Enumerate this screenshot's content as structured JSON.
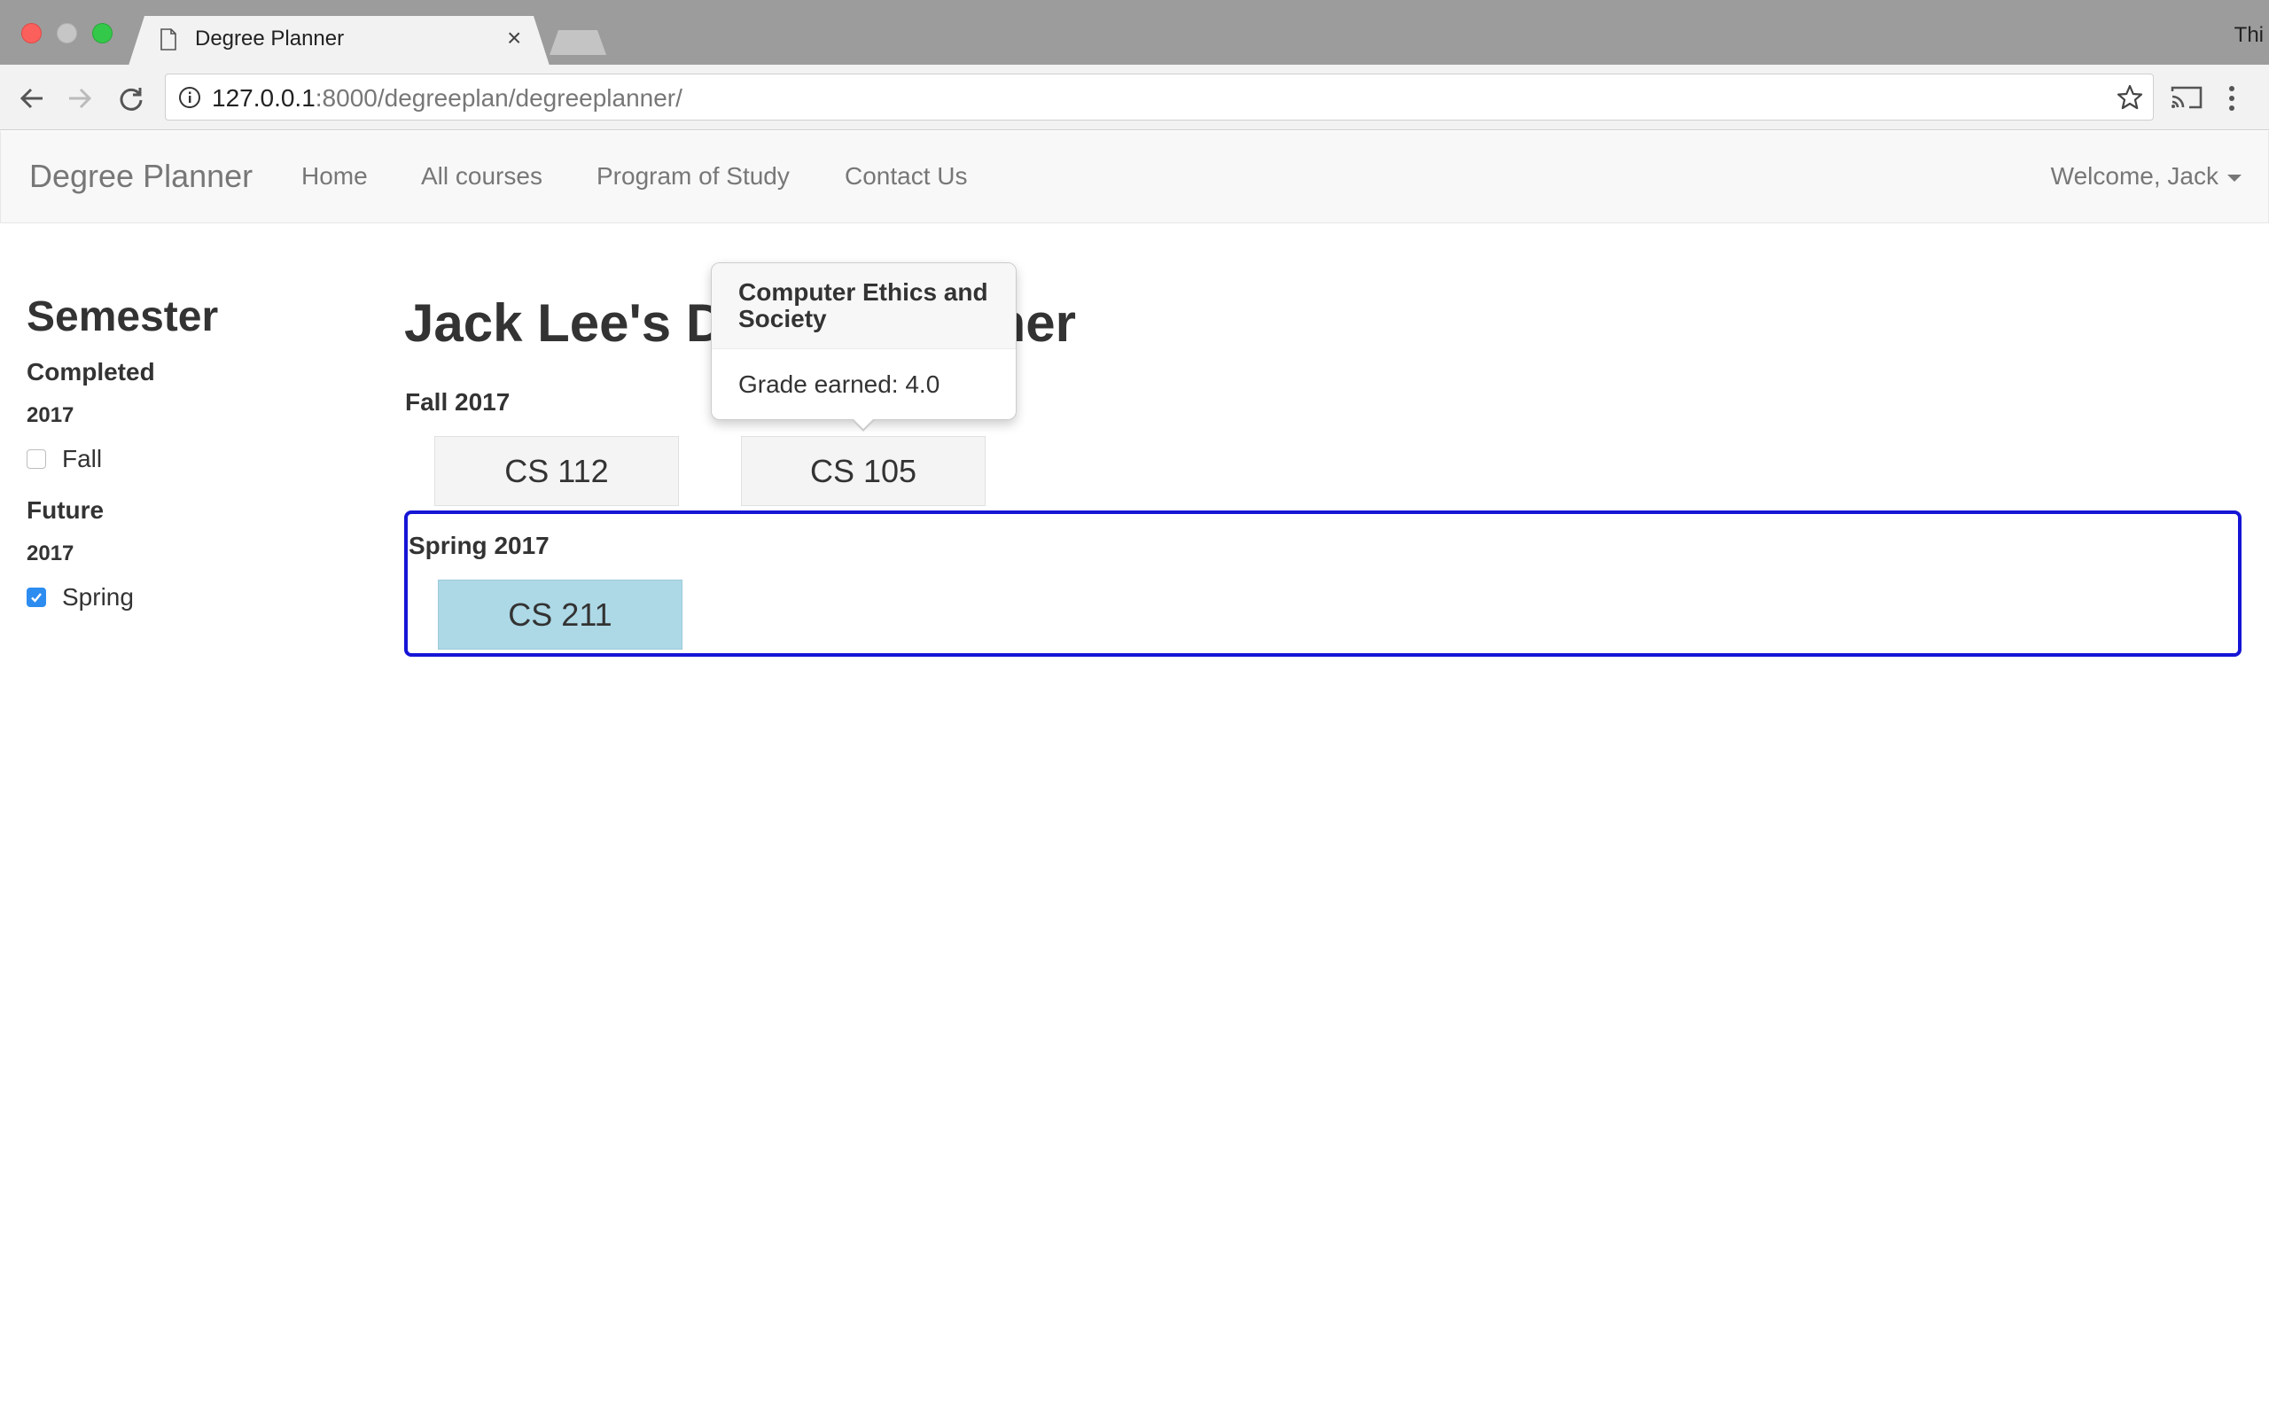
{
  "browser": {
    "tab_title": "Degree Planner",
    "profile_text": "Thi",
    "url_host": "127.0.0.1",
    "url_rest": ":8000/degreeplan/degreeplanner/"
  },
  "navbar": {
    "brand": "Degree Planner",
    "links": [
      "Home",
      "All courses",
      "Program of Study",
      "Contact Us"
    ],
    "welcome": "Welcome, Jack"
  },
  "sidebar": {
    "heading": "Semester",
    "completed": {
      "label": "Completed",
      "year": "2017",
      "items": [
        {
          "label": "Fall",
          "checked": false
        }
      ]
    },
    "future": {
      "label": "Future",
      "year": "2017",
      "items": [
        {
          "label": "Spring",
          "checked": true
        }
      ]
    }
  },
  "main": {
    "title": "Jack Lee's Degree Planner",
    "semesters": [
      {
        "label": "Fall 2017",
        "courses": [
          "CS 112",
          "CS 105"
        ]
      },
      {
        "label": "Spring 2017",
        "courses": [
          "CS 211"
        ]
      }
    ]
  },
  "popover": {
    "title": "Computer Ethics and Society",
    "body": "Grade earned: 4.0"
  },
  "colors": {
    "highlight_border": "#1515d6",
    "active_course": "#add8e6",
    "checkbox_checked": "#2d8cf0"
  }
}
